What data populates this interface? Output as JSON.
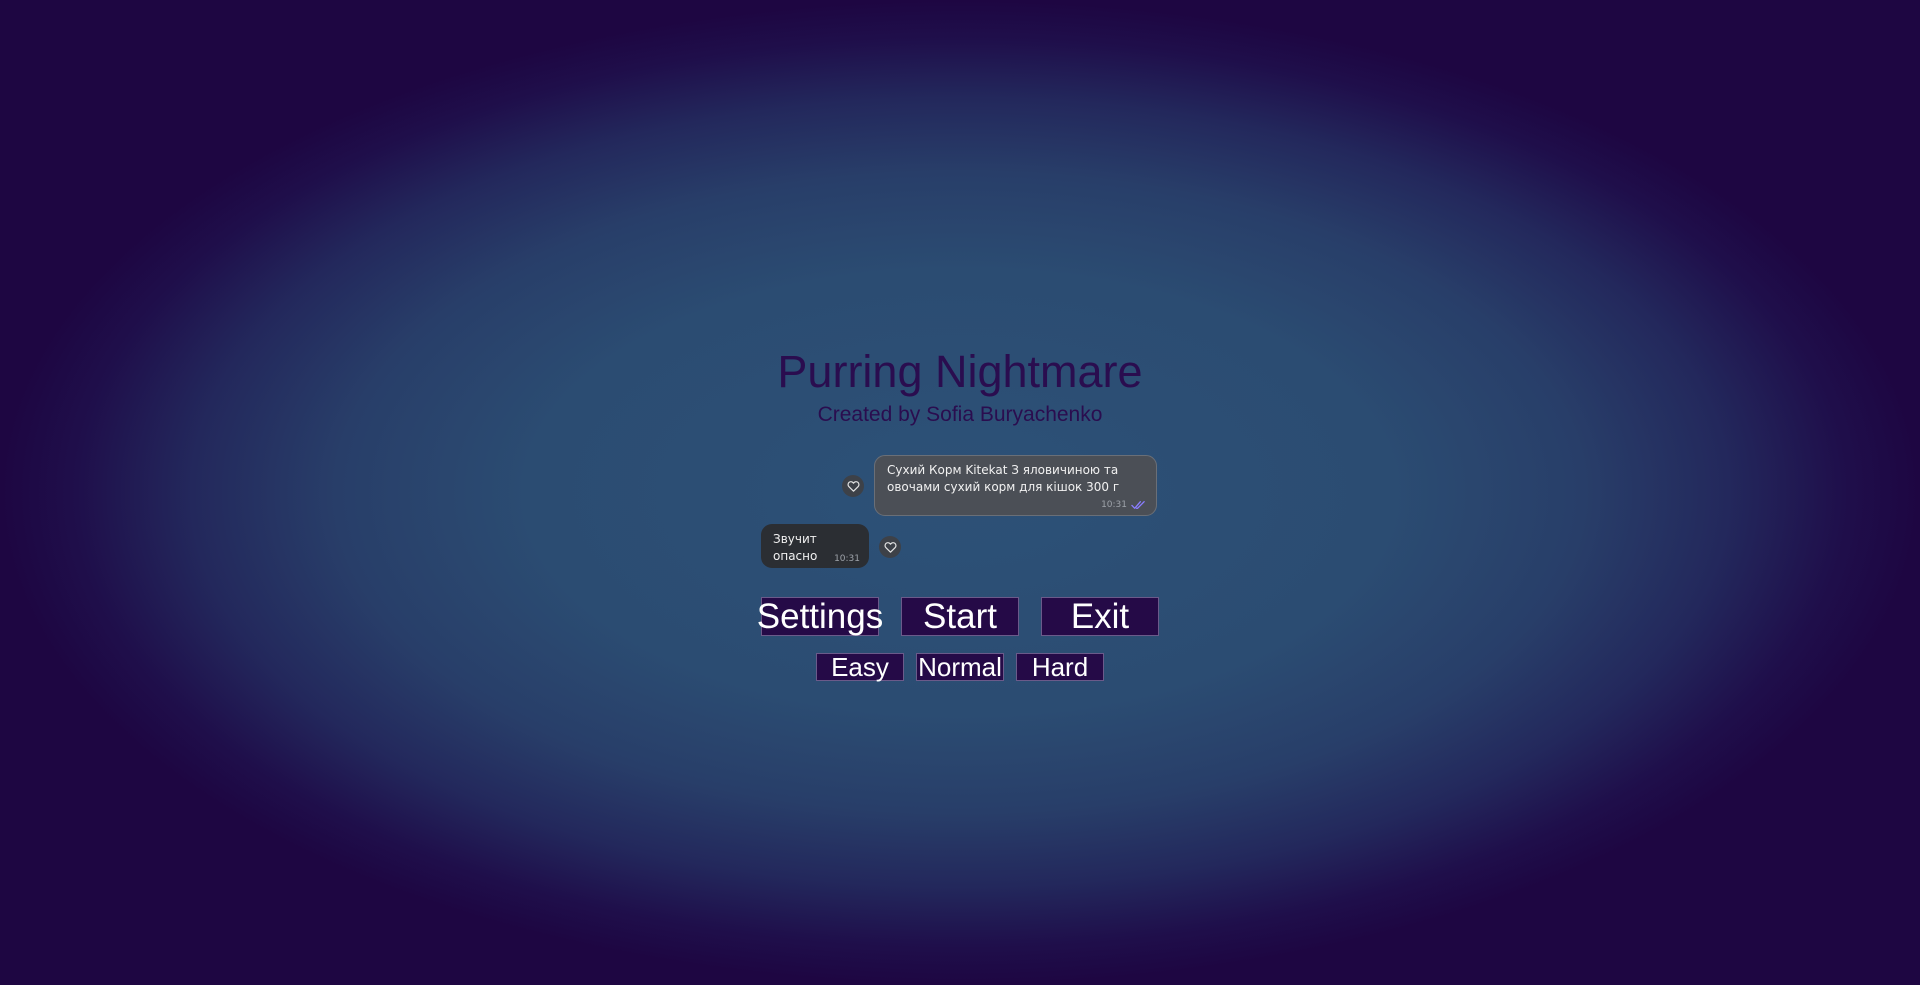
{
  "game": {
    "title": "Purring Nightmare",
    "subtitle": "Created by Sofia Buryachenko"
  },
  "chat": {
    "messages": [
      {
        "direction": "outgoing",
        "text": "Сухий Корм Kitekat З яловичиною та\nовочами сухий корм для кішок 300 г",
        "time": "10:31",
        "status": "read"
      },
      {
        "direction": "incoming",
        "text": "Звучит опасно",
        "time": "10:31"
      }
    ],
    "reaction_icon": "heart-outline-icon",
    "read_icon": "double-check-icon"
  },
  "menu": {
    "settings_label": "Settings",
    "start_label": "Start",
    "exit_label": "Exit"
  },
  "difficulty": {
    "easy_label": "Easy",
    "normal_label": "Normal",
    "hard_label": "Hard"
  },
  "colors": {
    "title_text": "#2a0d4f",
    "button_bg": "#250a47",
    "button_text": "#ffffff",
    "background_center": "#2d5177",
    "background_edge": "#1e0642",
    "outgoing_bubble": "#4b4f56",
    "incoming_bubble": "#2b2e33",
    "read_check": "#8a7dff"
  }
}
